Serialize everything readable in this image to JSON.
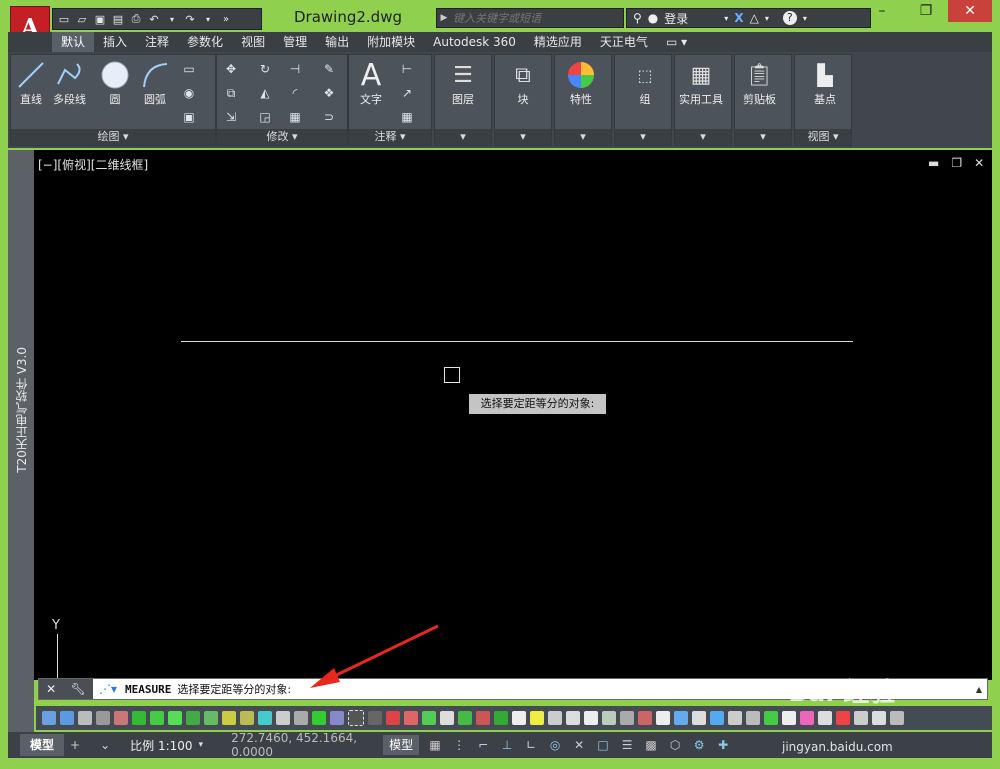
{
  "app": {
    "logo": "A",
    "document_title": "Drawing2.dwg"
  },
  "quick_access": [
    "new-icon",
    "open-icon",
    "save-icon",
    "saveas-icon",
    "print-icon",
    "undo-icon",
    "redo-icon"
  ],
  "search": {
    "placeholder": "键入关键字或短语"
  },
  "infocenter": {
    "login_label": "登录",
    "help": "?"
  },
  "ribbon_tabs": [
    "默认",
    "插入",
    "注释",
    "参数化",
    "视图",
    "管理",
    "输出",
    "附加模块",
    "Autodesk 360",
    "精选应用",
    "天正电气"
  ],
  "panels": {
    "draw": {
      "title": "绘图 ▾",
      "buttons": [
        "直线",
        "多段线",
        "圆",
        "圆弧"
      ]
    },
    "modify": {
      "title": "修改 ▾"
    },
    "annotate": {
      "title": "注释 ▾",
      "buttons": [
        "文字"
      ]
    },
    "layers": {
      "label": "图层"
    },
    "block": {
      "label": "块"
    },
    "properties": {
      "label": "特性"
    },
    "group": {
      "label": "组"
    },
    "utilities": {
      "label": "实用工具"
    },
    "clipboard": {
      "label": "剪贴板"
    },
    "view": {
      "label": "基点",
      "title": "视图 ▾"
    }
  },
  "side_label": "T20天正电气软件 V3.0",
  "viewport": {
    "label": "[−][俯视][二维线框]"
  },
  "tooltip": "选择要定距等分的对象:",
  "ucs": {
    "y_axis": "Y"
  },
  "command": {
    "name": "MEASURE",
    "prompt": "选择要定距等分的对象:"
  },
  "status": {
    "model_tab": "模型",
    "scale": "比例 1:100",
    "coordinates": "272.7460, 452.1664, 0.0000",
    "model_button": "模型"
  },
  "colors": {
    "title_bg": "#8fd14f",
    "canvas": "#000000",
    "close_btn": "#c8413a",
    "logo": "#c31f24"
  },
  "watermark": {
    "logo": "Bai 经验",
    "url": "jingyan.baidu.com"
  }
}
